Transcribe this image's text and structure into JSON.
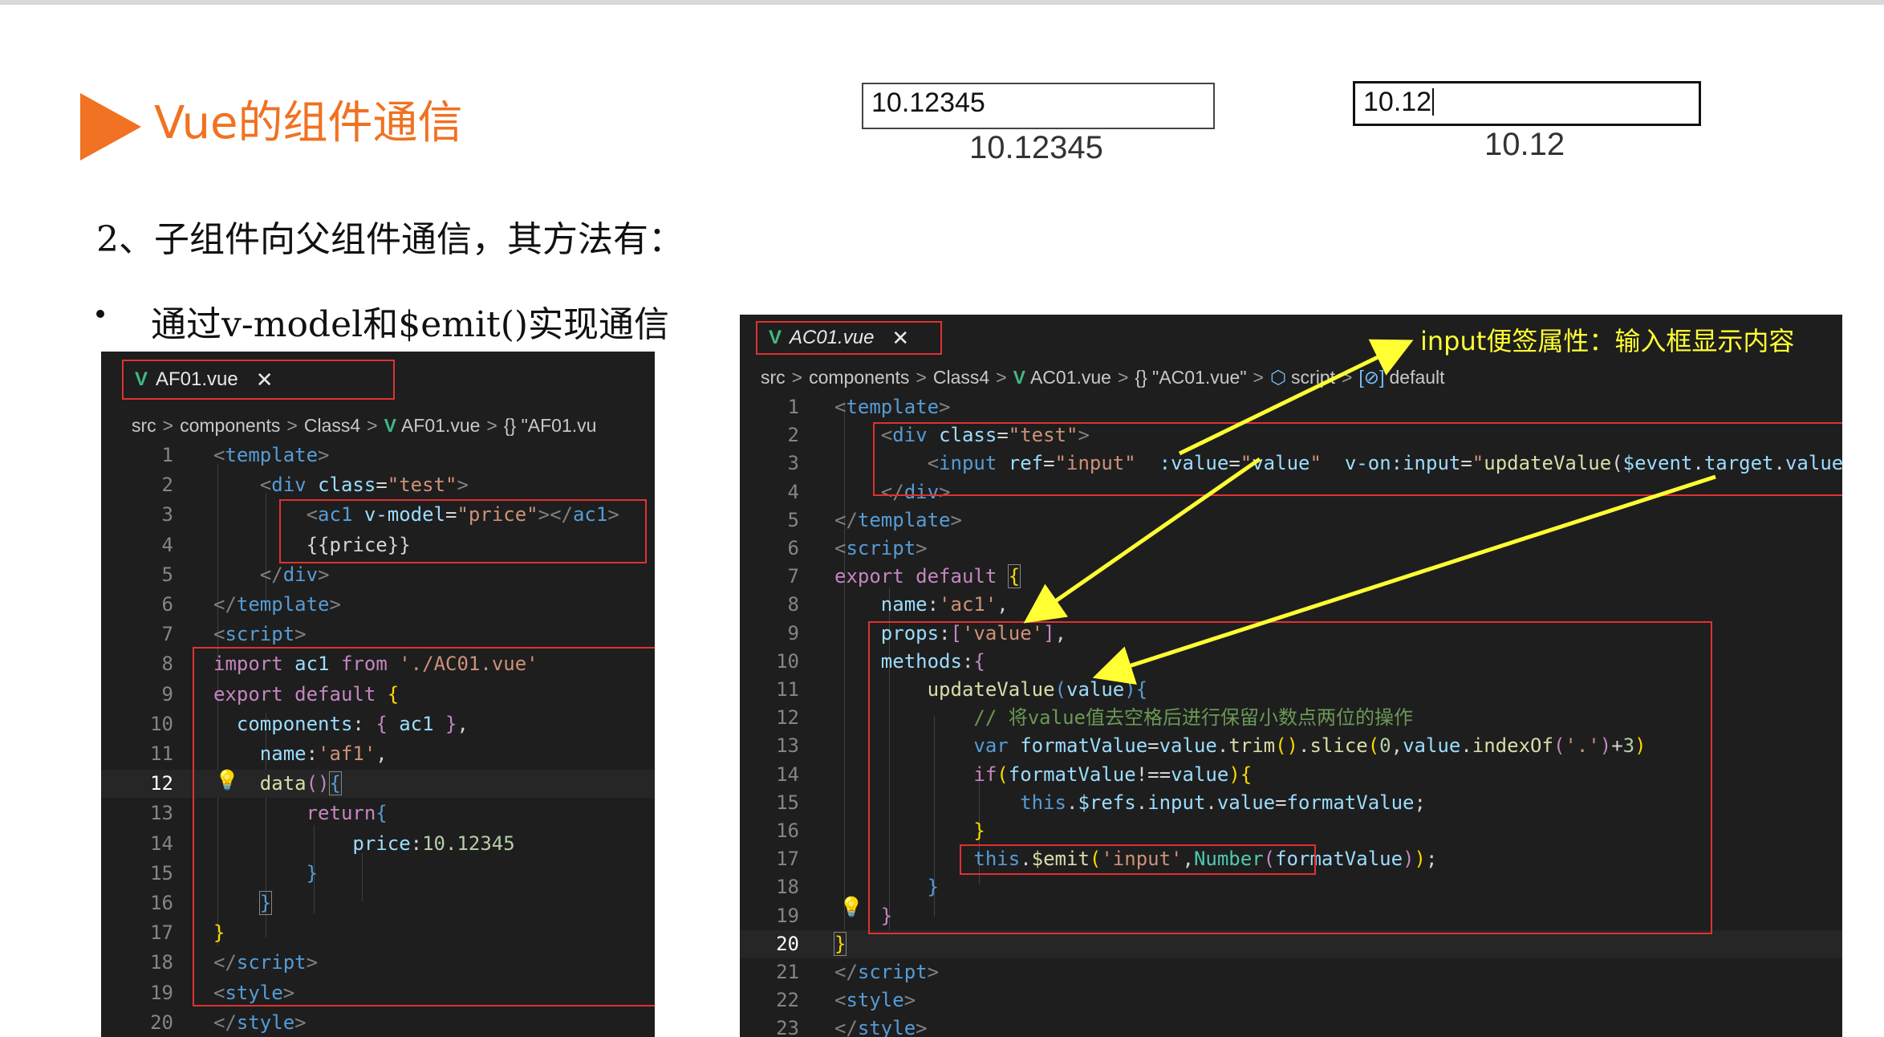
{
  "slide": {
    "title": "Vue的组件通信",
    "subtitle": "2、子组件向父组件通信，其方法有：",
    "bullet": "通过v-model和$emit()实现通信"
  },
  "demo": {
    "left_input_value": "10.12345",
    "left_display": "10.12345",
    "right_input_value": "10.12",
    "right_display": "10.12"
  },
  "left_editor": {
    "tab_label": "AF01.vue",
    "close_glyph": "✕",
    "breadcrumb": [
      "src",
      "components",
      "Class4",
      "AF01.vue",
      "{} \"AF01.vu"
    ],
    "lines": [
      "1",
      "2",
      "3",
      "4",
      "5",
      "6",
      "7",
      "8",
      "9",
      "10",
      "11",
      "12",
      "13",
      "14",
      "15",
      "16",
      "17",
      "18",
      "19",
      "20"
    ]
  },
  "right_editor": {
    "tab_label": "AC01.vue",
    "close_glyph": "✕",
    "breadcrumb": [
      "src",
      "components",
      "Class4",
      "AC01.vue",
      "{} \"AC01.vue\"",
      "script",
      "default"
    ],
    "lines": [
      "1",
      "2",
      "3",
      "4",
      "5",
      "6",
      "7",
      "8",
      "9",
      "10",
      "11",
      "12",
      "13",
      "14",
      "15",
      "16",
      "17",
      "18",
      "19",
      "20",
      "21",
      "22",
      "23"
    ],
    "annotation": "input便签属性：输入框显示内容"
  },
  "colors": {
    "accent": "#f07222",
    "highlight_box": "#e03131",
    "arrow": "#ffff33",
    "editor_bg": "#1e1e1e"
  },
  "icons": [
    "play-triangle-icon",
    "vue-logo-icon",
    "close-icon",
    "chevron-right-icon",
    "lightbulb-icon",
    "cube-icon",
    "variable-icon"
  ]
}
